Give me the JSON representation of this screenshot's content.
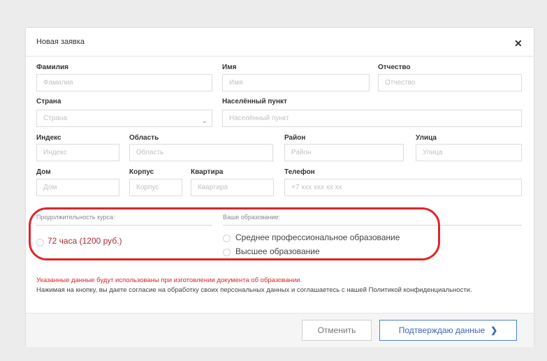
{
  "modal": {
    "title": "Новая заявка",
    "close_icon": "close-icon"
  },
  "fields": {
    "surname": {
      "label": "Фамилия",
      "placeholder": "Фамилия"
    },
    "name": {
      "label": "Имя",
      "placeholder": "Имя"
    },
    "patronymic": {
      "label": "Отчество",
      "placeholder": "Отчество"
    },
    "country": {
      "label": "Страна",
      "placeholder": "Страна"
    },
    "city": {
      "label": "Населённый пункт",
      "placeholder": "Населённый пункт"
    },
    "index": {
      "label": "Индекс",
      "placeholder": "Индекс"
    },
    "region": {
      "label": "Область",
      "placeholder": "Область"
    },
    "district": {
      "label": "Район",
      "placeholder": "Район"
    },
    "street": {
      "label": "Улица",
      "placeholder": "Улица"
    },
    "house": {
      "label": "Дом",
      "placeholder": "Дом"
    },
    "building": {
      "label": "Корпус",
      "placeholder": "Корпус"
    },
    "apartment": {
      "label": "Квартира",
      "placeholder": "Квартира"
    },
    "phone": {
      "label": "Телефон",
      "placeholder": "+7 xxx xxx xx xx"
    }
  },
  "course": {
    "label": "Продолжительность курса:",
    "options": [
      "72 часа (1200 руб.)"
    ]
  },
  "education": {
    "label": "Ваше образование:",
    "options": [
      "Среднее профессиональное образование",
      "Высшее образование"
    ]
  },
  "notice": {
    "warning": "Указанные данные будут использованы при изготовлении документа об образовании.",
    "consent": "Нажимая на кнопку, вы даете согласие на обработку своих персональных данных и соглашаетесь с нашей Политикой конфиденциальности."
  },
  "buttons": {
    "cancel": "Отменить",
    "confirm": "Подтверждаю данные",
    "confirm_icon": "chevron-right-icon"
  },
  "colors": {
    "highlight": "#e1242a",
    "accent": "#3a66b8",
    "warning": "#d9262b",
    "course_option": "#b3282f"
  }
}
